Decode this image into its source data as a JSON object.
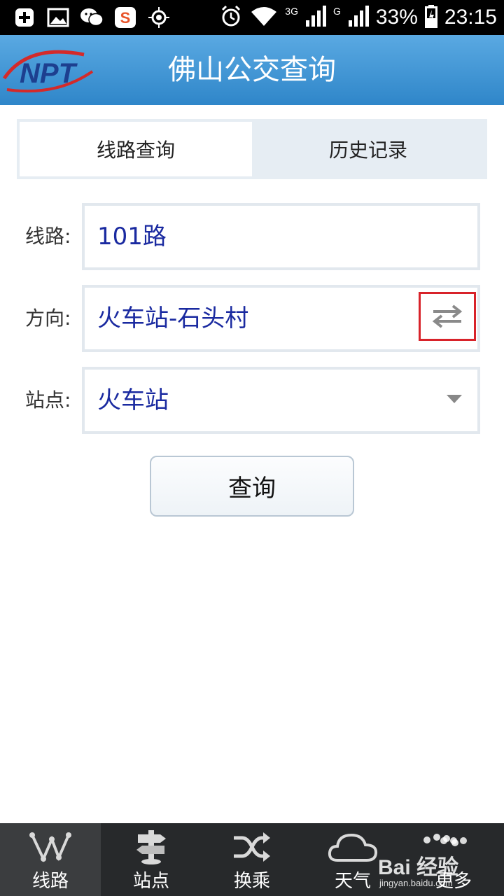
{
  "status_bar": {
    "signal_3g": "3G",
    "signal_g": "G",
    "battery": "33%",
    "time": "23:15"
  },
  "header": {
    "logo_text": "NPT",
    "title": "佛山公交查询"
  },
  "tabs": [
    {
      "label": "线路查询",
      "active": true
    },
    {
      "label": "历史记录",
      "active": false
    }
  ],
  "form": {
    "route_label": "线路:",
    "route_value": "101路",
    "direction_label": "方向:",
    "direction_value": "火车站-石头村",
    "stop_label": "站点:",
    "stop_value": "火车站",
    "query_button": "查询"
  },
  "bottom_nav": [
    {
      "label": "线路",
      "icon": "route-icon",
      "active": true
    },
    {
      "label": "站点",
      "icon": "signpost-icon",
      "active": false
    },
    {
      "label": "换乘",
      "icon": "shuffle-icon",
      "active": false
    },
    {
      "label": "天气",
      "icon": "cloud-icon",
      "active": false
    },
    {
      "label": "更多",
      "icon": "more-icon",
      "active": false
    }
  ],
  "watermark": {
    "text": "Bai 经验",
    "sub": "jingyan.baidu.com"
  },
  "colors": {
    "header": "#3a8fd0",
    "value_text": "#1a2aa0",
    "swap_highlight": "#d8232a",
    "nav_bg": "#27292b"
  }
}
